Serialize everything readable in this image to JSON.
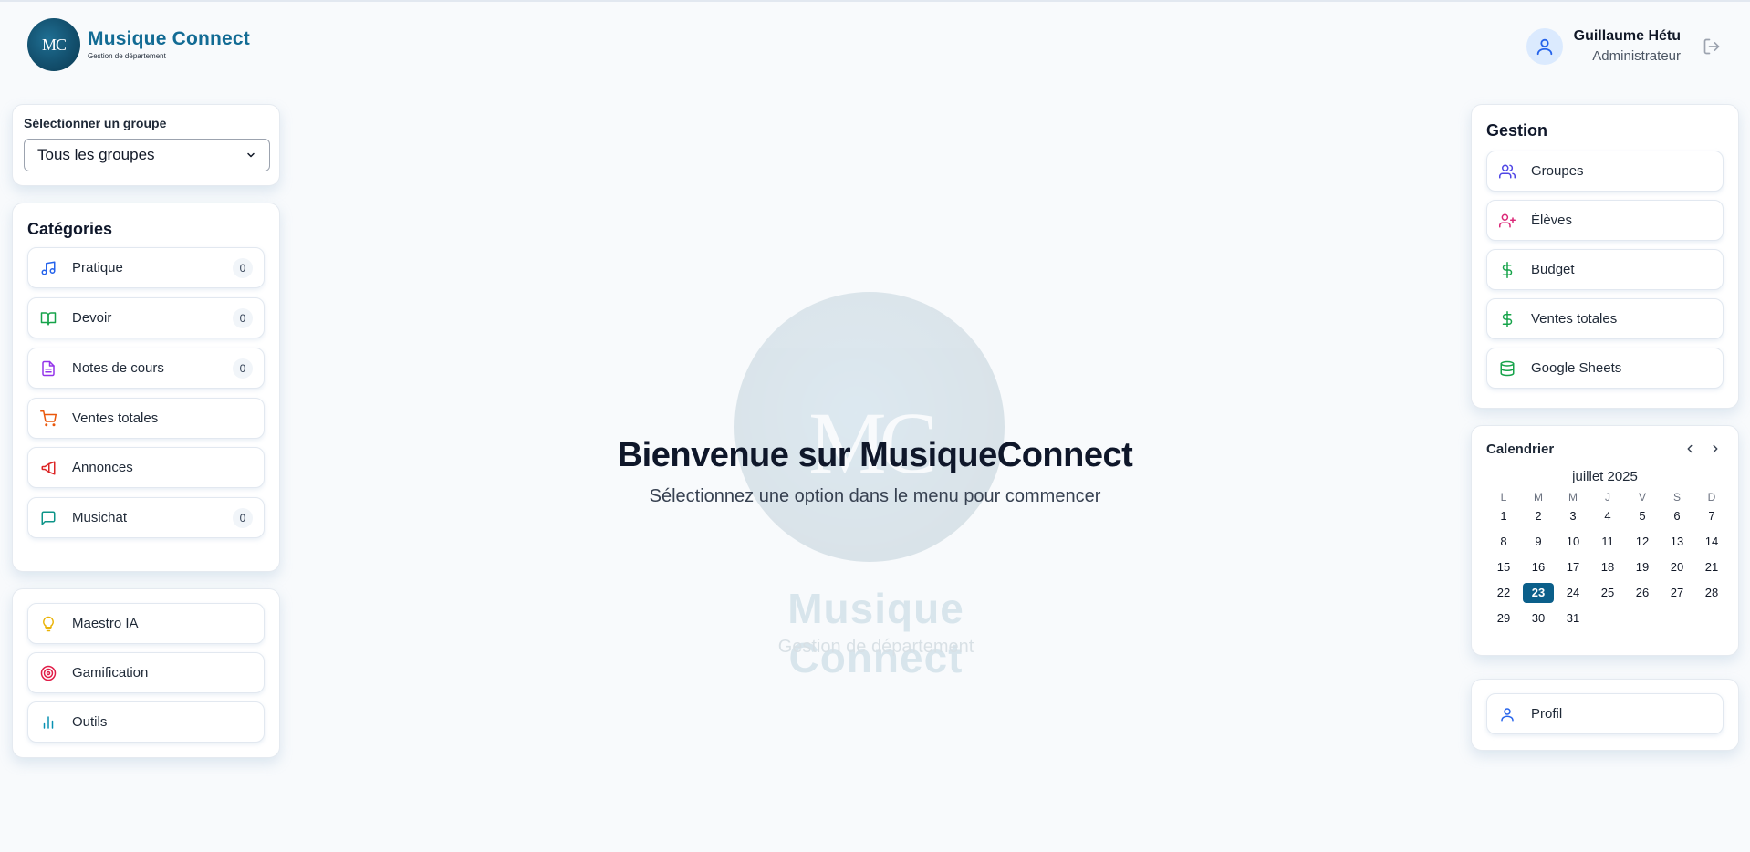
{
  "brand": {
    "logo_text": "MC",
    "name": "Musique Connect",
    "subtitle": "Gestion de département"
  },
  "user": {
    "name": "Guillaume Hétu",
    "role": "Administrateur"
  },
  "group_selector": {
    "label": "Sélectionner un groupe",
    "value": "Tous les groupes"
  },
  "categories": {
    "title": "Catégories",
    "items": [
      {
        "label": "Pratique",
        "count": "0",
        "icon": "music-note-icon",
        "color": "#2563eb"
      },
      {
        "label": "Devoir",
        "count": "0",
        "icon": "book-icon",
        "color": "#16a34a"
      },
      {
        "label": "Notes de cours",
        "count": "0",
        "icon": "document-icon",
        "color": "#9333ea"
      },
      {
        "label": "Ventes totales",
        "icon": "cart-icon",
        "color": "#ea580c"
      },
      {
        "label": "Annonces",
        "icon": "megaphone-icon",
        "color": "#dc2626"
      },
      {
        "label": "Musichat",
        "count": "0",
        "icon": "chat-icon",
        "color": "#0d9488"
      }
    ]
  },
  "tools": {
    "items": [
      {
        "label": "Maestro IA",
        "icon": "lightbulb-icon",
        "color": "#eab308"
      },
      {
        "label": "Gamification",
        "icon": "target-icon",
        "color": "#e11d48"
      },
      {
        "label": "Outils",
        "icon": "bar-chart-icon",
        "color": "#0891b2"
      }
    ]
  },
  "welcome": {
    "title": "Bienvenue sur MusiqueConnect",
    "subtitle": "Sélectionnez une option dans le menu pour commencer",
    "watermark_initials": "MC",
    "watermark_name": "Musique Connect",
    "watermark_subtitle": "Gestion de département"
  },
  "gestion": {
    "title": "Gestion",
    "items": [
      {
        "label": "Groupes",
        "icon": "users-icon",
        "color": "#4f46e5"
      },
      {
        "label": "Élèves",
        "icon": "user-plus-icon",
        "color": "#db2777"
      },
      {
        "label": "Budget",
        "icon": "dollar-icon",
        "color": "#16a34a"
      },
      {
        "label": "Ventes totales",
        "icon": "dollar-icon",
        "color": "#16a34a"
      },
      {
        "label": "Google Sheets",
        "icon": "database-icon",
        "color": "#16a34a"
      }
    ]
  },
  "calendar": {
    "title": "Calendrier",
    "month": "juillet 2025",
    "weekdays": [
      "L",
      "M",
      "M",
      "J",
      "V",
      "S",
      "D"
    ],
    "days": [
      "1",
      "2",
      "3",
      "4",
      "5",
      "6",
      "7",
      "8",
      "9",
      "10",
      "11",
      "12",
      "13",
      "14",
      "15",
      "16",
      "17",
      "18",
      "19",
      "20",
      "21",
      "22",
      "23",
      "24",
      "25",
      "26",
      "27",
      "28",
      "29",
      "30",
      "31"
    ],
    "today": "23",
    "accent": "#0b5f8a"
  },
  "profile": {
    "label": "Profil",
    "icon": "user-icon",
    "color": "#2563eb"
  }
}
